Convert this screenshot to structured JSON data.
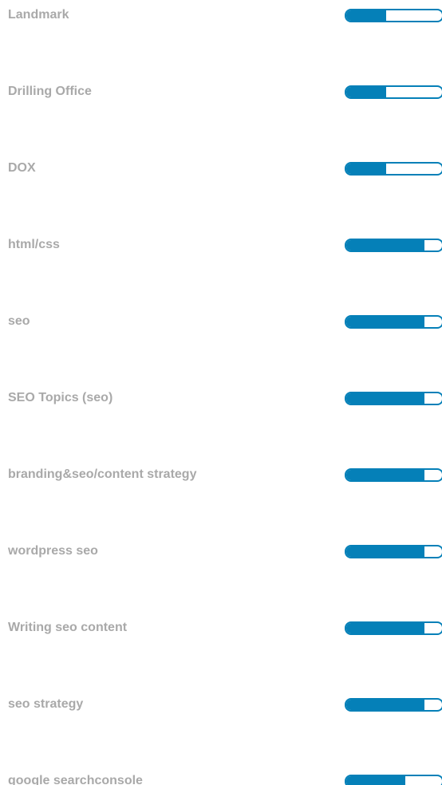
{
  "theme": {
    "accent": "#0580b8",
    "label_color": "#a9a9a9",
    "bar_bg": "#ffffff"
  },
  "skills": [
    {
      "label": "Landmark",
      "level": 0.42
    },
    {
      "label": "Drilling Office",
      "level": 0.42
    },
    {
      "label": "DOX",
      "level": 0.42
    },
    {
      "label": "html/css",
      "level": 0.82
    },
    {
      "label": "seo",
      "level": 0.82
    },
    {
      "label": "SEO Topics (seo)",
      "level": 0.82
    },
    {
      "label": "branding&seo/content strategy",
      "level": 0.82
    },
    {
      "label": "wordpress seo",
      "level": 0.82
    },
    {
      "label": "Writing seo content",
      "level": 0.82
    },
    {
      "label": "seo strategy",
      "level": 0.82
    },
    {
      "label": "google searchconsole",
      "level": 0.62
    }
  ]
}
